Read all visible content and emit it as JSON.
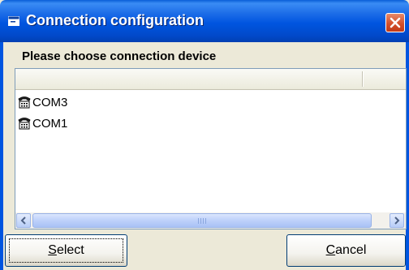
{
  "window": {
    "title": "Connection configuration",
    "close_label": "X"
  },
  "heading": "Please choose connection device",
  "devices": [
    {
      "label": "COM3",
      "icon": "telephone-icon"
    },
    {
      "label": "COM1",
      "icon": "telephone-icon"
    }
  ],
  "scrollbar": {
    "grip_icon": "scroll-grip"
  },
  "buttons": {
    "select": {
      "mnemonic": "S",
      "rest": "elect"
    },
    "cancel": {
      "mnemonic": "C",
      "rest": "ancel"
    }
  }
}
